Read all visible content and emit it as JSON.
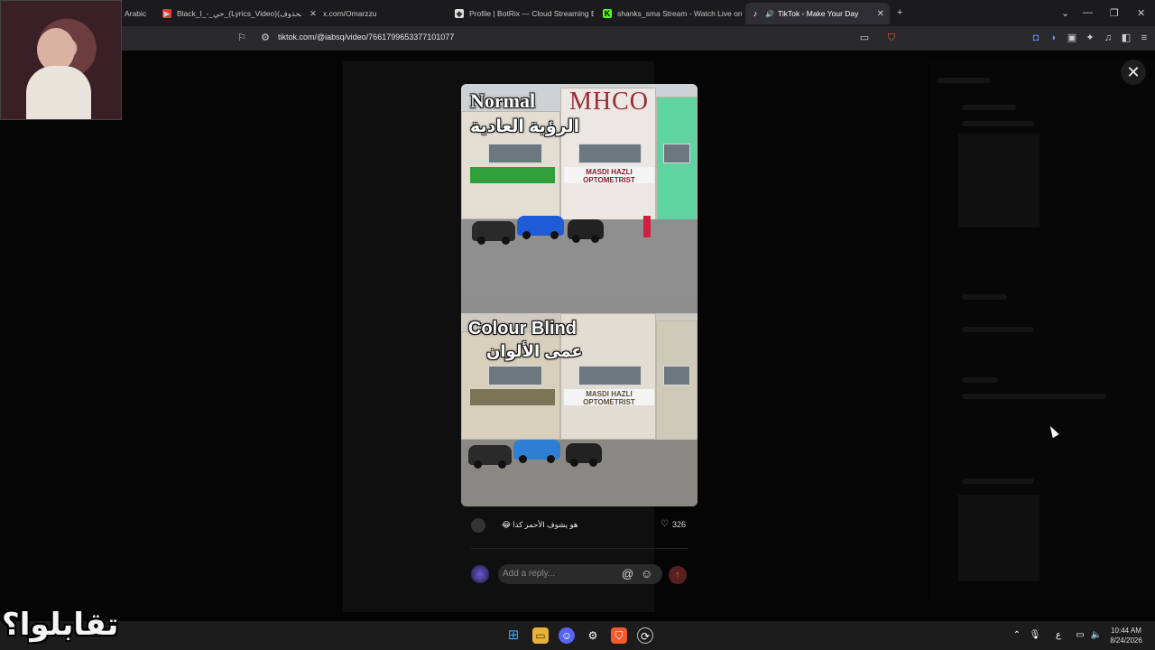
{
  "browser": {
    "tabs": [
      {
        "label": "Arabic",
        "icon": "generic-icon"
      },
      {
        "label": "Black_I_-_حي_(Lyrics_Video)(محذوف) -",
        "icon": "youtube-icon"
      },
      {
        "label": "x.com/Omarzzu",
        "icon": "x-icon"
      },
      {
        "label": "Profile | BotRix — Cloud Streaming B",
        "icon": "botrix-icon"
      },
      {
        "label": "shanks_sma Stream - Watch Live on",
        "icon": "kick-icon"
      },
      {
        "label": "TikTok - Make Your Day",
        "icon": "tiktok-icon"
      }
    ],
    "url": "tiktok.com/@iabsq/video/7661799653377101077"
  },
  "video": {
    "top_label": "Normal",
    "top_label_ar": "الرؤية العادية",
    "bottom_label": "Colour Blind",
    "bottom_label_ar": "عمى الألوان",
    "logo": "MHCO",
    "shop_sign": "MASDI HAZLI OPTOMETRIST",
    "shop_sign_bottom": "MASDI HAZLI OPTOMETRIST"
  },
  "comment": {
    "text": "هو يشوف الأحمر كذا 😂",
    "likes": "326"
  },
  "reply": {
    "placeholder": "Add a reply..."
  },
  "taskbar": {
    "time": "10:44 AM",
    "date": "8/24/2026",
    "lang": "ع"
  },
  "overlay": {
    "watermark": "تقابلوا؟"
  },
  "colors": {
    "accent": "#c9372c",
    "tab_active": "#2f2f33"
  }
}
